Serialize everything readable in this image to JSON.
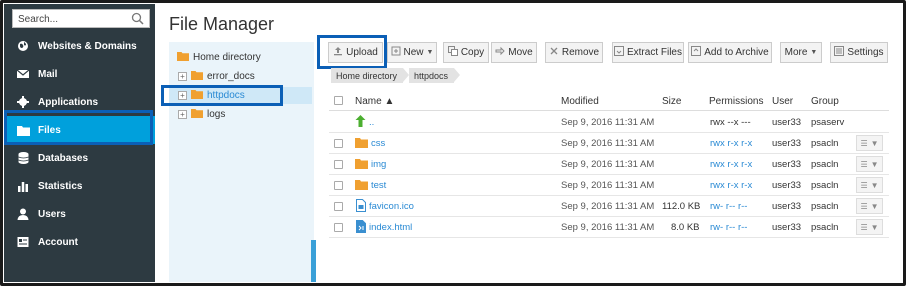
{
  "search": {
    "placeholder": "Search..."
  },
  "sidebar": {
    "items": [
      {
        "label": "Websites & Domains",
        "icon": "globe-icon"
      },
      {
        "label": "Mail",
        "icon": "envelope-icon"
      },
      {
        "label": "Applications",
        "icon": "gear-icon"
      },
      {
        "label": "Files",
        "icon": "folder-icon",
        "active": true
      },
      {
        "label": "Databases",
        "icon": "database-icon"
      },
      {
        "label": "Statistics",
        "icon": "bar-chart-icon"
      },
      {
        "label": "Users",
        "icon": "user-icon"
      },
      {
        "label": "Account",
        "icon": "account-icon"
      }
    ]
  },
  "page": {
    "title": "File Manager"
  },
  "tree": {
    "items": [
      {
        "label": "Home directory"
      },
      {
        "label": "error_docs"
      },
      {
        "label": "httpdocs",
        "selected": true
      },
      {
        "label": "logs"
      }
    ]
  },
  "toolbar": {
    "upload": "Upload",
    "new": "New",
    "copy": "Copy",
    "move": "Move",
    "remove": "Remove",
    "extract": "Extract Files",
    "archive": "Add to Archive",
    "more": "More",
    "settings": "Settings"
  },
  "breadcrumb": [
    "Home directory",
    "httpdocs"
  ],
  "table": {
    "headers": {
      "name": "Name",
      "modified": "Modified",
      "size": "Size",
      "permissions": "Permissions",
      "user": "User",
      "group": "Group"
    },
    "rows": [
      {
        "name": "..",
        "modified": "Sep 9, 2016 11:31 AM",
        "size": "",
        "permissions": "rwx --x ---",
        "user": "user33",
        "group": "psaserv",
        "type": "up"
      },
      {
        "name": "css",
        "modified": "Sep 9, 2016 11:31 AM",
        "size": "",
        "permissions": "rwx r-x r-x",
        "user": "user33",
        "group": "psacln",
        "type": "folder"
      },
      {
        "name": "img",
        "modified": "Sep 9, 2016 11:31 AM",
        "size": "",
        "permissions": "rwx r-x r-x",
        "user": "user33",
        "group": "psacln",
        "type": "folder"
      },
      {
        "name": "test",
        "modified": "Sep 9, 2016 11:31 AM",
        "size": "",
        "permissions": "rwx r-x r-x",
        "user": "user33",
        "group": "psacln",
        "type": "folder"
      },
      {
        "name": "favicon.ico",
        "modified": "Sep 9, 2016 11:31 AM",
        "size": "112.0 KB",
        "permissions": "rw- r-- r--",
        "user": "user33",
        "group": "psacln",
        "type": "file"
      },
      {
        "name": "index.html",
        "modified": "Sep 9, 2016 11:31 AM",
        "size": "8.0 KB",
        "permissions": "rw- r-- r--",
        "user": "user33",
        "group": "psacln",
        "type": "html"
      }
    ]
  },
  "colors": {
    "sidebar_bg": "#2d3a41",
    "active_bg": "#00a0dc",
    "highlight_border": "#0b5fb6",
    "link": "#2a8ad4",
    "folder": "#f0a030"
  }
}
